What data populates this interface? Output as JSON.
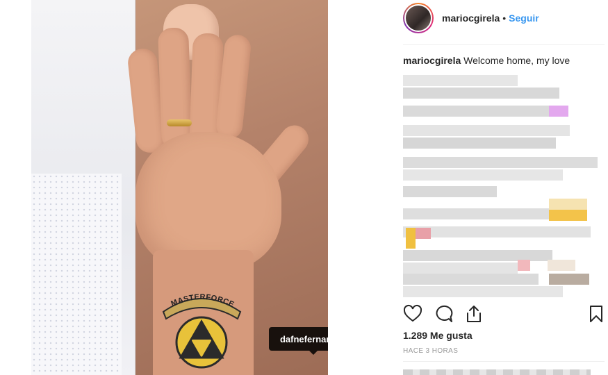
{
  "post": {
    "username": "mariocgirela",
    "follow_label": "Seguir",
    "caption_user": "mariocgirela",
    "caption_text": "Welcome home, my love",
    "photo_tag": "dafnefernandez",
    "tattoo_text": "MASTERFORCE",
    "likes": "1.289 Me gusta",
    "time": "HACE 3 HORAS"
  },
  "colors": {
    "follow": "#3897f0",
    "text": "#262626",
    "muted": "#999999"
  },
  "icons": {
    "like": "heart-icon",
    "comment": "comment-icon",
    "share": "share-icon",
    "save": "bookmark-icon"
  }
}
